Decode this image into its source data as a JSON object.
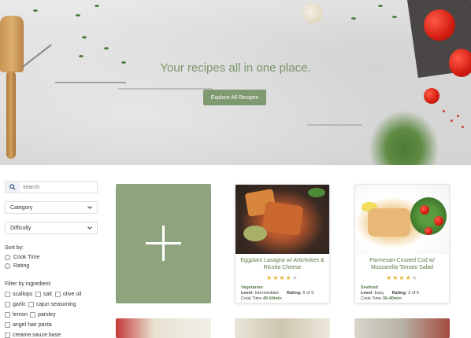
{
  "hero": {
    "title": "Your recipes all in one place.",
    "button": "Explore All Recipes"
  },
  "sidebar": {
    "search_placeholder": "search",
    "category": "Category",
    "difficulty": "Difficulty",
    "sort_label": "Sort by:",
    "sort_options": [
      "Cook Time",
      "Rating"
    ],
    "filter_label": "Filter by ingredient:",
    "ingredients": [
      "scallops",
      "salt",
      "olive oil",
      "garlic",
      "cajun seasoning",
      "lemon",
      "parsley",
      "angel hair pasta",
      "creame sauce base"
    ]
  },
  "cards": [
    {
      "title": "Eggplant Lasagna w/ Artichokes & Ricotta Cheese",
      "rating": 4,
      "category": "Vegetarian",
      "level_label": "Level:",
      "level": "Intermediate",
      "rating_label": "Rating:",
      "rating_text": "5 of 5",
      "cook_label": "Cook Time",
      "cook_time": "40-50min"
    },
    {
      "title": "Parmesan-Crusted Cod w/ Mozzarella-Tomato Salad",
      "rating": 4,
      "category": "Seafood",
      "level_label": "Level:",
      "level": "Easy",
      "rating_label": "Rating:",
      "rating_text": "3 of 5",
      "cook_label": "Cook Time",
      "cook_time": "30-40min"
    }
  ],
  "colors": {
    "accent": "#7f9a70",
    "add_card": "#8ea47f",
    "star": "#e4b32c"
  }
}
